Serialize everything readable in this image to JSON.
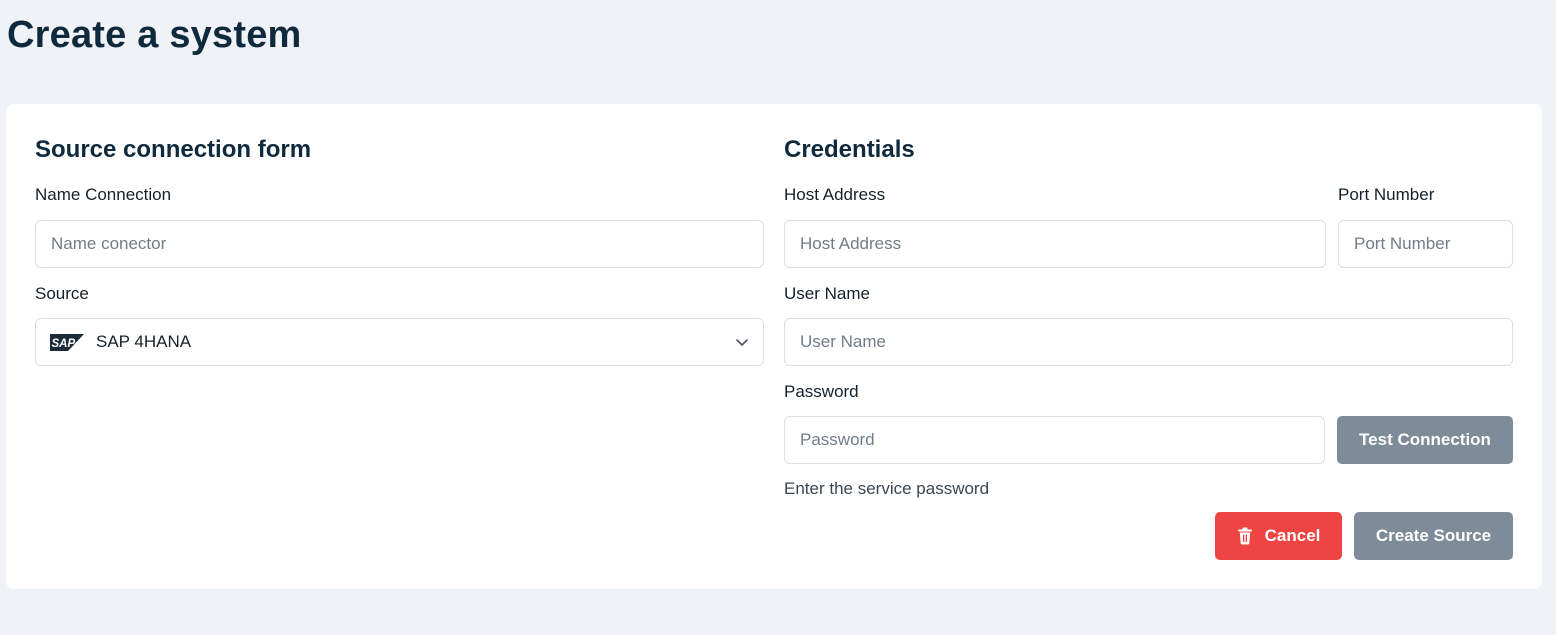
{
  "page": {
    "title": "Create a system"
  },
  "source_form": {
    "title": "Source connection form",
    "name_label": "Name Connection",
    "name_placeholder": "Name conector",
    "name_value": "",
    "source_label": "Source",
    "source_value": "SAP 4HANA",
    "source_logo_text": "SAP",
    "source_icon": "sap-logo-icon"
  },
  "credentials": {
    "title": "Credentials",
    "host_label": "Host Address",
    "host_placeholder": "Host Address",
    "port_label": "Port Number",
    "port_placeholder": "Port Number",
    "user_label": "User Name",
    "user_placeholder": "User Name",
    "password_label": "Password",
    "password_placeholder": "Password",
    "password_hint": "Enter the service password",
    "test_button": "Test Connection"
  },
  "actions": {
    "cancel_label": "Cancel",
    "cancel_icon": "trash-icon",
    "create_label": "Create Source"
  },
  "colors": {
    "background": "#eff3f8",
    "card": "#ffffff",
    "title_text": "#0f2a3d",
    "button_disabled": "#7d8c98",
    "button_danger": "#ef4444"
  }
}
